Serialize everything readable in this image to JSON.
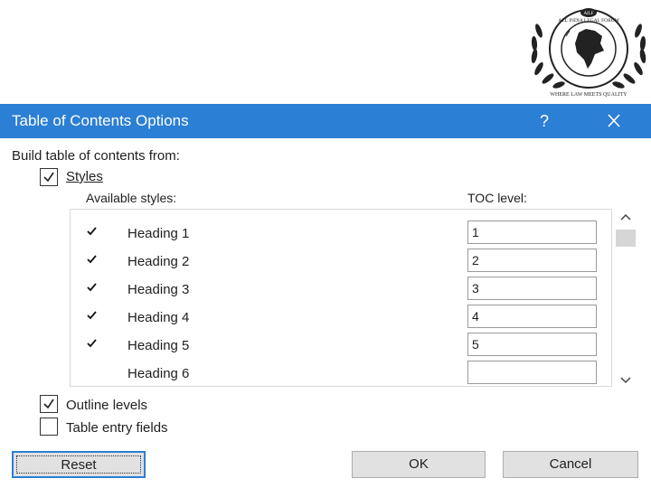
{
  "logo": {
    "top_text": "ALL INDIA LEGAL FORUM",
    "badge_text": "AILF",
    "bottom_text": "WHERE LAW MEETS QUALITY"
  },
  "dialog": {
    "title": "Table of Contents Options",
    "help_symbol": "?",
    "close_icon": "close-icon",
    "accent_color": "#2b7fd4",
    "build_label": "Build table of contents from:",
    "styles_checkbox": {
      "label": "Styles",
      "checked": true
    },
    "available_styles_header": "Available styles:",
    "toc_level_header": "TOC level:",
    "style_rows": [
      {
        "name": "Heading 1",
        "level": "1",
        "ticked": true
      },
      {
        "name": "Heading 2",
        "level": "2",
        "ticked": true
      },
      {
        "name": "Heading 3",
        "level": "3",
        "ticked": true
      },
      {
        "name": "Heading 4",
        "level": "4",
        "ticked": true
      },
      {
        "name": "Heading 5",
        "level": "5",
        "ticked": true
      },
      {
        "name": "Heading 6",
        "level": "",
        "ticked": false
      }
    ],
    "outline_levels": {
      "label": "Outline levels",
      "checked": true
    },
    "table_entry_fields": {
      "label": "Table entry fields",
      "checked": false
    },
    "buttons": {
      "reset": "Reset",
      "ok": "OK",
      "cancel": "Cancel"
    }
  }
}
